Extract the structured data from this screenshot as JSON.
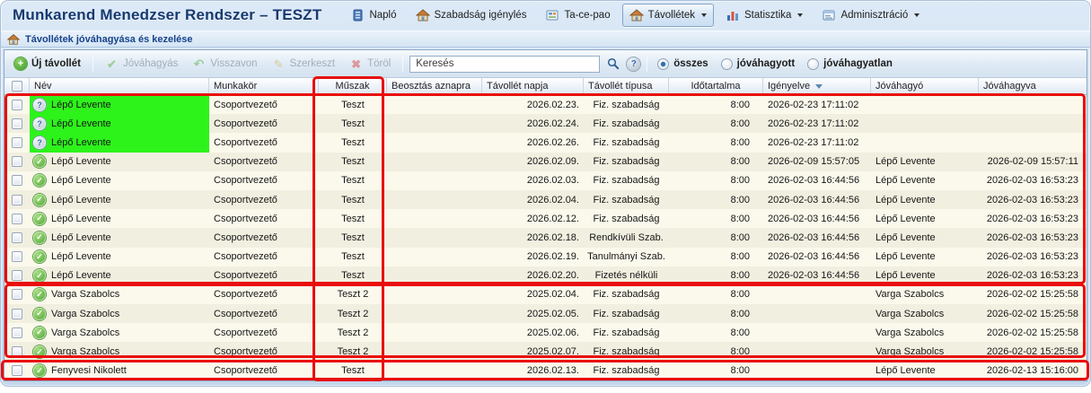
{
  "app": {
    "title": "Munkarend Menedzser Rendszer – TESZT"
  },
  "menu": {
    "items": [
      {
        "label": "Napló",
        "icon": "journal-icon",
        "active": false,
        "dropdown": false
      },
      {
        "label": "Szabadság igénylés",
        "icon": "home-icon",
        "active": false,
        "dropdown": false
      },
      {
        "label": "Ta-ce-pao",
        "icon": "board-icon",
        "active": false,
        "dropdown": false
      },
      {
        "label": "Távollétek",
        "icon": "home-icon",
        "active": true,
        "dropdown": true
      },
      {
        "label": "Statisztika",
        "icon": "chart-icon",
        "active": false,
        "dropdown": true
      },
      {
        "label": "Adminisztráció",
        "icon": "form-icon",
        "active": false,
        "dropdown": true
      }
    ]
  },
  "breadcrumb": {
    "title": "Távollétek jóváhagyása és kezelése"
  },
  "toolbar": {
    "new_button": "Új távollét",
    "approve_button": "Jóváhagyás",
    "revoke_button": "Visszavon",
    "edit_button": "Szerkeszt",
    "delete_button": "Töröl",
    "search_placeholder": "Keresés",
    "filters": [
      {
        "label": "összes",
        "selected": true
      },
      {
        "label": "jóváhagyott",
        "selected": false
      },
      {
        "label": "jóváhagyatlan",
        "selected": false
      }
    ]
  },
  "table": {
    "columns": [
      "",
      "Név",
      "Munkakör",
      "Műszak",
      "Beosztás aznapra",
      "Távollét napja",
      "Távollét típusa",
      "Időtartalma",
      "Igényelve",
      "Jóváhagyó",
      "Jóváhagyva"
    ],
    "sorted_column": "Igényelve",
    "sort_direction": "desc",
    "rows": [
      {
        "status": "pending",
        "highlight": true,
        "name": "Lépő Levente",
        "job": "Csoportvezető",
        "shift": "Teszt",
        "assignment": "",
        "absence_date": "2026.02.23.",
        "absence_type": "Fiz. szabadság",
        "duration": "8:00",
        "requested": "2026-02-23 17:11:02",
        "approver": "",
        "approved_at": ""
      },
      {
        "status": "pending",
        "highlight": true,
        "name": "Lépő Levente",
        "job": "Csoportvezető",
        "shift": "Teszt",
        "assignment": "",
        "absence_date": "2026.02.24.",
        "absence_type": "Fiz. szabadság",
        "duration": "8:00",
        "requested": "2026-02-23 17:11:02",
        "approver": "",
        "approved_at": ""
      },
      {
        "status": "pending",
        "highlight": true,
        "name": "Lépő Levente",
        "job": "Csoportvezető",
        "shift": "Teszt",
        "assignment": "",
        "absence_date": "2026.02.26.",
        "absence_type": "Fiz. szabadság",
        "duration": "8:00",
        "requested": "2026-02-23 17:11:02",
        "approver": "",
        "approved_at": ""
      },
      {
        "status": "approved",
        "highlight": false,
        "name": "Lépő Levente",
        "job": "Csoportvezető",
        "shift": "Teszt",
        "assignment": "",
        "absence_date": "2026.02.09.",
        "absence_type": "Fiz. szabadság",
        "duration": "8:00",
        "requested": "2026-02-09 15:57:05",
        "approver": "Lépő Levente",
        "approved_at": "2026-02-09 15:57:11"
      },
      {
        "status": "approved",
        "highlight": false,
        "name": "Lépő Levente",
        "job": "Csoportvezető",
        "shift": "Teszt",
        "assignment": "",
        "absence_date": "2026.02.03.",
        "absence_type": "Fiz. szabadság",
        "duration": "8:00",
        "requested": "2026-02-03 16:44:56",
        "approver": "Lépő Levente",
        "approved_at": "2026-02-03 16:53:23"
      },
      {
        "status": "approved",
        "highlight": false,
        "name": "Lépő Levente",
        "job": "Csoportvezető",
        "shift": "Teszt",
        "assignment": "",
        "absence_date": "2026.02.04.",
        "absence_type": "Fiz. szabadság",
        "duration": "8:00",
        "requested": "2026-02-03 16:44:56",
        "approver": "Lépő Levente",
        "approved_at": "2026-02-03 16:53:23"
      },
      {
        "status": "approved",
        "highlight": false,
        "name": "Lépő Levente",
        "job": "Csoportvezető",
        "shift": "Teszt",
        "assignment": "",
        "absence_date": "2026.02.12.",
        "absence_type": "Fiz. szabadság",
        "duration": "8:00",
        "requested": "2026-02-03 16:44:56",
        "approver": "Lépő Levente",
        "approved_at": "2026-02-03 16:53:23"
      },
      {
        "status": "approved",
        "highlight": false,
        "name": "Lépő Levente",
        "job": "Csoportvezető",
        "shift": "Teszt",
        "assignment": "",
        "absence_date": "2026.02.18.",
        "absence_type": "Rendkívüli Szab.",
        "duration": "8:00",
        "requested": "2026-02-03 16:44:56",
        "approver": "Lépő Levente",
        "approved_at": "2026-02-03 16:53:23"
      },
      {
        "status": "approved",
        "highlight": false,
        "name": "Lépő Levente",
        "job": "Csoportvezető",
        "shift": "Teszt",
        "assignment": "",
        "absence_date": "2026.02.19.",
        "absence_type": "Tanulmányi Szab.",
        "duration": "8:00",
        "requested": "2026-02-03 16:44:56",
        "approver": "Lépő Levente",
        "approved_at": "2026-02-03 16:53:23"
      },
      {
        "status": "approved",
        "highlight": false,
        "name": "Lépő Levente",
        "job": "Csoportvezető",
        "shift": "Teszt",
        "assignment": "",
        "absence_date": "2026.02.20.",
        "absence_type": "Fizetés nélküli",
        "duration": "8:00",
        "requested": "2026-02-03 16:44:56",
        "approver": "Lépő Levente",
        "approved_at": "2026-02-03 16:53:23"
      },
      {
        "status": "approved",
        "highlight": false,
        "name": "Varga Szabolcs",
        "job": "Csoportvezető",
        "shift": "Teszt 2",
        "assignment": "",
        "absence_date": "2025.02.04.",
        "absence_type": "Fiz. szabadság",
        "duration": "8:00",
        "requested": "",
        "approver": "Varga Szabolcs",
        "approved_at": "2026-02-02 15:25:58"
      },
      {
        "status": "approved",
        "highlight": false,
        "name": "Varga Szabolcs",
        "job": "Csoportvezető",
        "shift": "Teszt 2",
        "assignment": "",
        "absence_date": "2025.02.05.",
        "absence_type": "Fiz. szabadság",
        "duration": "8:00",
        "requested": "",
        "approver": "Varga Szabolcs",
        "approved_at": "2026-02-02 15:25:58"
      },
      {
        "status": "approved",
        "highlight": false,
        "name": "Varga Szabolcs",
        "job": "Csoportvezető",
        "shift": "Teszt 2",
        "assignment": "",
        "absence_date": "2025.02.06.",
        "absence_type": "Fiz. szabadság",
        "duration": "8:00",
        "requested": "",
        "approver": "Varga Szabolcs",
        "approved_at": "2026-02-02 15:25:58"
      },
      {
        "status": "approved",
        "highlight": false,
        "name": "Varga Szabolcs",
        "job": "Csoportvezető",
        "shift": "Teszt 2",
        "assignment": "",
        "absence_date": "2025.02.07.",
        "absence_type": "Fiz. szabadság",
        "duration": "8:00",
        "requested": "",
        "approver": "Varga Szabolcs",
        "approved_at": "2026-02-02 15:25:58"
      },
      {
        "status": "approved",
        "highlight": false,
        "name": "Fenyvesi Nikolett",
        "job": "Csoportvezető",
        "shift": "Teszt",
        "assignment": "",
        "absence_date": "2026.02.13.",
        "absence_type": "Fiz. szabadság",
        "duration": "8:00",
        "requested": "",
        "approver": "Lépő Levente",
        "approved_at": "2026-02-13 15:16:00"
      }
    ]
  },
  "colors": {
    "highlight_green": "#2df31b",
    "annotation_red": "#ea0c0c",
    "title_blue": "#16396f",
    "breadcrumb_blue": "#15428b"
  }
}
